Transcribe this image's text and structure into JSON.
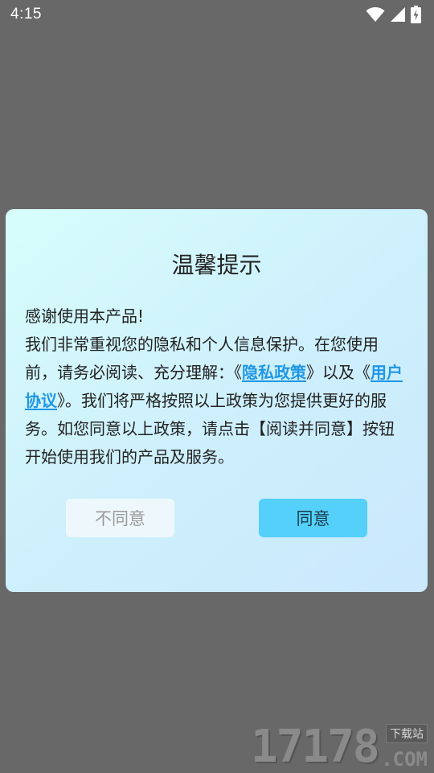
{
  "status_bar": {
    "time": "4:15",
    "icons": [
      "wifi-icon",
      "cell-signal-icon",
      "battery-charging-icon"
    ]
  },
  "dialog": {
    "title": "温馨提示",
    "body": {
      "line1": "感谢使用本产品!",
      "para_part1": "我们非常重视您的隐私和个人信息保护。在您使用前，请务必阅读、充分理解：《",
      "privacy_link": "隐私政策",
      "para_part2": "》以及《",
      "agreement_link": "用户协议",
      "para_part3": "》。我们将严格按照以上政策为您提供更好的服务。如您同意以上政策，请点击【阅读并同意】按钮开始使用我们的产品及服务。"
    },
    "buttons": {
      "disagree": "不同意",
      "agree": "同意"
    }
  },
  "watermark": {
    "digits": "17178",
    "tag": "下载站",
    "domain": ".COM"
  },
  "colors": {
    "overlay": "#686868",
    "link": "#1f97e6",
    "agree_button": "#54d0fb",
    "disagree_button": "#eef8fc"
  }
}
